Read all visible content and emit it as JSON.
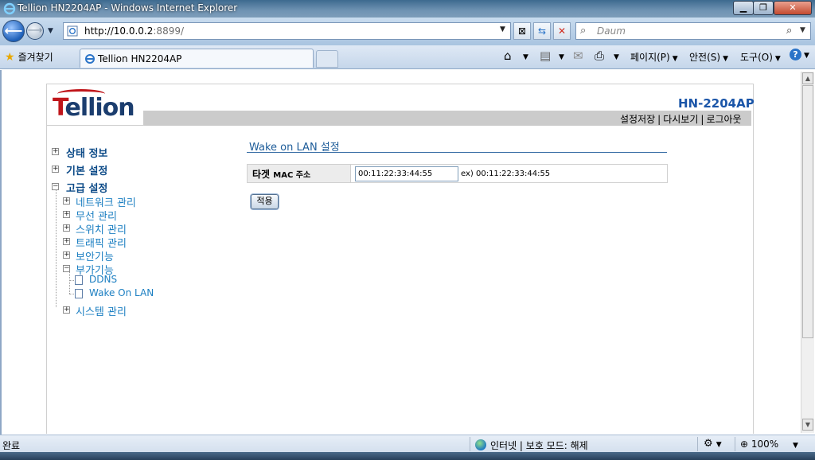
{
  "window": {
    "title": "Tellion HN2204AP - Windows Internet Explorer",
    "min_glyph": "▁",
    "max_glyph": "❐",
    "close_glyph": "✕"
  },
  "browser": {
    "url_host": "http://10.0.0.2",
    "url_rest": ":8899/",
    "search_placeholder": "Daum",
    "favorites_label": "즐겨찾기",
    "tab_label": "Tellion HN2204AP",
    "menu": {
      "page": "페이지(P)",
      "safety": "안전(S)",
      "tools": "도구(O)",
      "help": "?"
    }
  },
  "header": {
    "logo_text": "Tellion",
    "model": "HN-2204AP",
    "links": [
      "설정저장",
      "다시보기",
      "로그아웃"
    ],
    "separator": "|"
  },
  "sidebar": {
    "status_info": "상태 정보",
    "basic_settings": "기본 설정",
    "advanced_settings": "고급 설정",
    "advanced_items": [
      "네트워크 관리",
      "무선 관리",
      "스위치 관리",
      "트래픽 관리",
      "보안기능",
      "부가기능",
      "시스템 관리"
    ],
    "addon_items": [
      "DDNS",
      "Wake On LAN"
    ]
  },
  "main": {
    "section_title": "Wake on LAN 설정",
    "field_label_a": "타겟",
    "field_label_b": "MAC 주소",
    "mac_value": "00:11:22:33:44:55",
    "example": "ex) 00:11:22:33:44:55",
    "apply_label": "적용"
  },
  "statusbar": {
    "done": "완료",
    "zone": "인터넷 | 보호 모드: 해제",
    "zoom": "100%"
  },
  "colors": {
    "accent": "#1a55a8",
    "sidebar_link": "#1c7fc2",
    "sidebar_heading": "#0d4b88",
    "logo_red": "#c0161b"
  }
}
